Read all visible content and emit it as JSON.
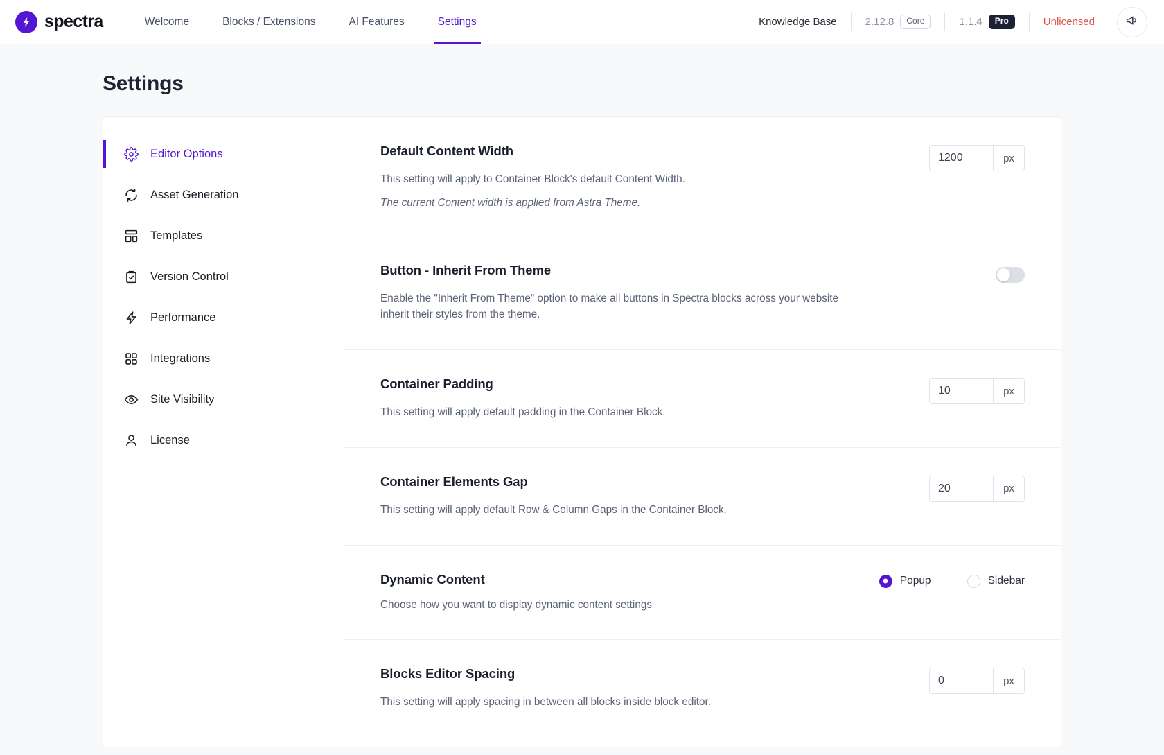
{
  "header": {
    "brand_name": "spectra",
    "brand_icon": "spectra-bolt-logo",
    "nav": [
      {
        "label": "Welcome",
        "active": false
      },
      {
        "label": "Blocks / Extensions",
        "active": false
      },
      {
        "label": "AI Features",
        "active": false
      },
      {
        "label": "Settings",
        "active": true
      }
    ],
    "knowledge_base_label": "Knowledge Base",
    "core_version": "2.12.8",
    "core_badge": "Core",
    "pro_version": "1.1.4",
    "pro_badge": "Pro",
    "license_status": "Unlicensed",
    "announce_icon": "megaphone-icon",
    "accent_color": "#5216d4",
    "status_color": "#e0564f"
  },
  "page": {
    "title": "Settings"
  },
  "sidebar": {
    "items": [
      {
        "label": "Editor Options",
        "icon": "gear-icon",
        "active": true
      },
      {
        "label": "Asset Generation",
        "icon": "refresh-icon",
        "active": false
      },
      {
        "label": "Templates",
        "icon": "layout-icon",
        "active": false
      },
      {
        "label": "Version Control",
        "icon": "clipboard-check-icon",
        "active": false
      },
      {
        "label": "Performance",
        "icon": "lightning-icon",
        "active": false
      },
      {
        "label": "Integrations",
        "icon": "grid-icon",
        "active": false
      },
      {
        "label": "Site Visibility",
        "icon": "eye-icon",
        "active": false
      },
      {
        "label": "License",
        "icon": "user-icon",
        "active": false
      }
    ]
  },
  "settings": {
    "default_content_width": {
      "title": "Default Content Width",
      "description": "This setting will apply to Container Block's default Content Width.",
      "note": "The current Content width is applied from Astra Theme.",
      "value": "1200",
      "unit": "px"
    },
    "button_inherit": {
      "title": "Button - Inherit From Theme",
      "description": "Enable the \"Inherit From Theme\" option to make all buttons in Spectra blocks across your website inherit their styles from the theme.",
      "toggle_state": "off"
    },
    "container_padding": {
      "title": "Container Padding",
      "description": "This setting will apply default padding in the Container Block.",
      "value": "10",
      "unit": "px"
    },
    "container_elements_gap": {
      "title": "Container Elements Gap",
      "description": "This setting will apply default Row & Column Gaps in the Container Block.",
      "value": "20",
      "unit": "px"
    },
    "dynamic_content": {
      "title": "Dynamic Content",
      "description": "Choose how you want to display dynamic content settings",
      "options": [
        {
          "label": "Popup",
          "selected": true
        },
        {
          "label": "Sidebar",
          "selected": false
        }
      ]
    },
    "blocks_editor_spacing": {
      "title": "Blocks Editor Spacing",
      "description": "This setting will apply spacing in between all blocks inside block editor.",
      "value": "0",
      "unit": "px"
    }
  }
}
